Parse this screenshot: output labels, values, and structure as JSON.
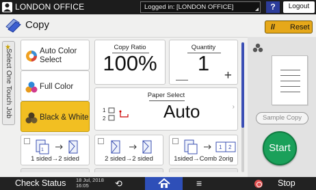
{
  "topbar": {
    "title": "LONDON OFFICE",
    "login_status": "Logged in: [LONDON OFFICE]",
    "help_label": "?",
    "logout_label": "Logout"
  },
  "header": {
    "app_title": "Copy",
    "reset_label": "Reset",
    "reset_icon": "//"
  },
  "side_tab": {
    "label": "Select One Touch Job"
  },
  "color_modes": [
    {
      "label": "Auto Color Select",
      "icon": "auto-color-icon",
      "selected": false
    },
    {
      "label": "Full Color",
      "icon": "full-color-icon",
      "selected": false
    },
    {
      "label": "Black & White",
      "icon": "black-white-icon",
      "selected": true
    }
  ],
  "copy_ratio": {
    "caption": "Copy Ratio",
    "value": "100%"
  },
  "quantity": {
    "caption": "Quantity",
    "value": "1",
    "minus": "—",
    "plus": "+"
  },
  "paper_select": {
    "caption": "Paper Select",
    "value": "Auto",
    "tray_1": "1",
    "tray_2": "2",
    "arrow": "›"
  },
  "duplex_options": [
    {
      "label": "1 sided→2 sided",
      "icon": "one-to-two-sided-icon",
      "checked": false
    },
    {
      "label": "2 sided→2 sided",
      "icon": "two-to-two-sided-icon",
      "checked": false
    },
    {
      "label": "1sided→Comb 2orig",
      "icon": "combine-icon",
      "checked": false,
      "combine_text": "1 2"
    }
  ],
  "right_panel": {
    "sample_copy_label": "Sample Copy",
    "start_label": "Start"
  },
  "bottombar": {
    "check_status_label": "Check Status",
    "date": "18 Jul, 2018",
    "time": "16:05",
    "back_glyph": "⟲",
    "menu_glyph": "≡",
    "stop_label": "Stop"
  },
  "colors": {
    "accent_yellow": "#f2bf22",
    "reset_orange": "#e6a81a",
    "start_green": "#1aa05a",
    "home_blue": "#2e4fb8",
    "topbar_black": "#1c1c1c"
  }
}
